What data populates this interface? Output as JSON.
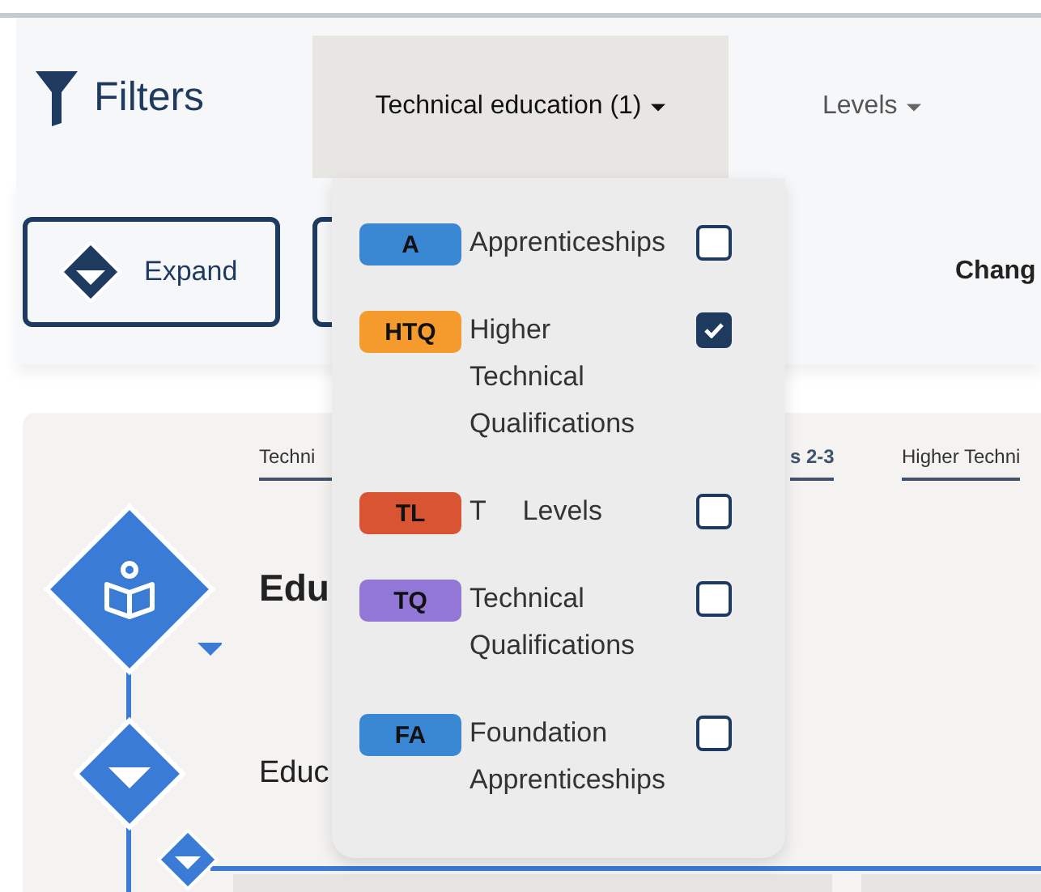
{
  "header": {
    "title": "Filters",
    "tabs": [
      {
        "label": "Technical education (1)",
        "selected": true
      },
      {
        "label": "Levels",
        "selected": false
      }
    ]
  },
  "toolbar": {
    "expand_button": "Expand",
    "right_label": "Chang"
  },
  "timeline": {
    "column_headers": [
      {
        "label": "Techni",
        "bold": false
      },
      {
        "label": "s 2-3",
        "bold": true
      },
      {
        "label": "Higher Techni",
        "bold": false
      }
    ],
    "rows": [
      {
        "label": "Edu",
        "kind": "heading"
      },
      {
        "label": "Educ",
        "kind": "sub"
      }
    ]
  },
  "dropdown": {
    "items": [
      {
        "badge": "A",
        "color": "#3a87d4",
        "label": "Apprenticeships",
        "checked": false
      },
      {
        "badge": "HTQ",
        "color": "#f59b2e",
        "label": "Higher Technical Qualifications",
        "checked": true
      },
      {
        "badge": "TL",
        "color": "#d95433",
        "label": "T Levels",
        "checked": false
      },
      {
        "badge": "TQ",
        "color": "#9277d6",
        "label": "Technical Qualifications",
        "checked": false
      },
      {
        "badge": "FA",
        "color": "#3a87d4",
        "label": "Foundation Apprenticeships",
        "checked": false
      }
    ]
  }
}
